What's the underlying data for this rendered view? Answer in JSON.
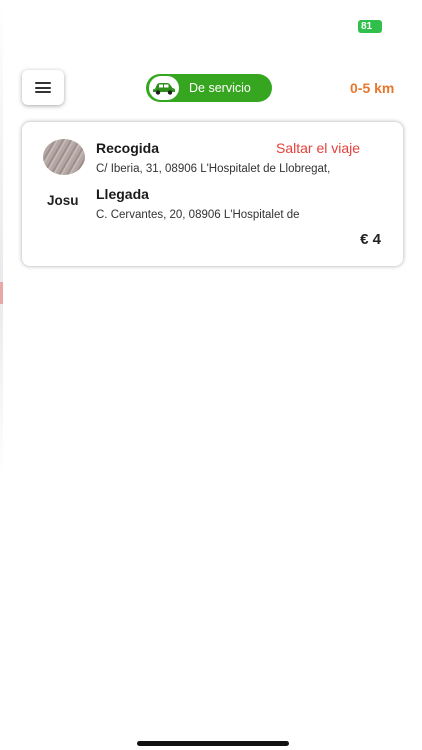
{
  "status_bar": {
    "battery_text": "81",
    "battery_color": "#2fbf4a"
  },
  "header": {
    "menu_icon": "hamburger-menu-icon",
    "service_status_label": "De servicio",
    "service_toggle_on": true,
    "service_toggle_icon": "car-icon",
    "distance_filter": "0-5 km"
  },
  "trip": {
    "passenger_name": "Josu",
    "pickup_title": "Recogida",
    "pickup_address": "C/ Iberia, 31, 08906 L'Hospitalet de Llobregat,",
    "dropoff_title": "Llegada",
    "dropoff_address": "C. Cervantes, 20, 08906 L'Hospitalet de",
    "skip_label": "Saltar el viaje",
    "fare": "€ 4"
  },
  "colors": {
    "service_green": "#36a620",
    "distance_orange": "#e8772e",
    "skip_red": "#e5413a"
  }
}
